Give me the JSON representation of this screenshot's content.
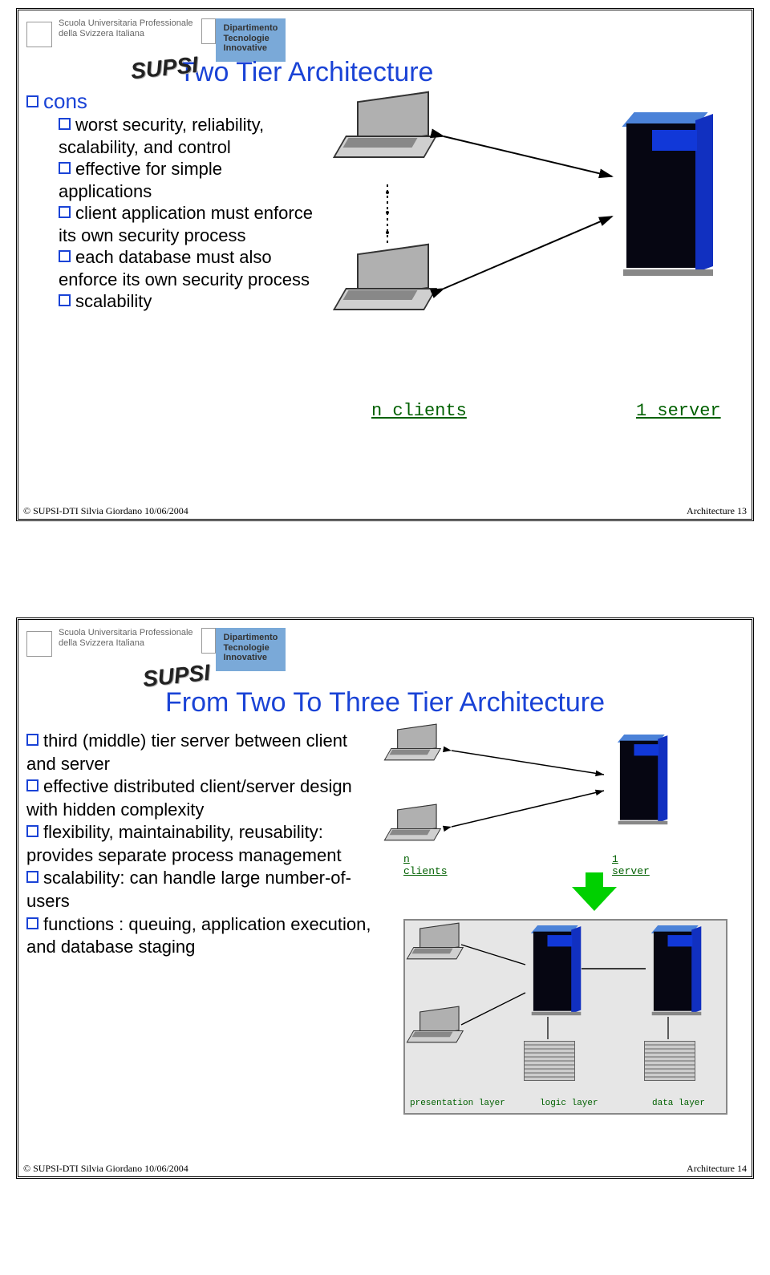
{
  "slide1": {
    "header": {
      "uni_line1": "Scuola Universitaria Professionale",
      "uni_line2": "della Svizzera Italiana",
      "logo": "SUPSI",
      "dip_line1": "Dipartimento",
      "dip_line2": "Tecnologie",
      "dip_line3": "Innovative"
    },
    "title": "Two Tier Architecture",
    "head_bullet": "cons",
    "bullets": [
      "worst security, reliability, scalability, and control",
      "effective for simple applications",
      "client application must enforce its own security process",
      "each database must also enforce its own security process",
      "scalability"
    ],
    "diagram": {
      "clients_label": "n clients",
      "server_label": "1 server"
    },
    "footer": {
      "left": "© SUPSI-DTI    Silvia Giordano    10/06/2004",
      "right": "Architecture  13"
    }
  },
  "slide2": {
    "header": {
      "uni_line1": "Scuola Universitaria Professionale",
      "uni_line2": "della Svizzera Italiana",
      "logo": "SUPSI",
      "dip_line1": "Dipartimento",
      "dip_line2": "Tecnologie",
      "dip_line3": "Innovative"
    },
    "title": "From Two To Three Tier Architecture",
    "bullets": [
      "third (middle) tier server between client and server",
      "effective distributed client/server design with hidden complexity",
      "flexibility, maintainability, reusability: provides separate process management",
      "scalability: can handle large number-of-users",
      "functions : queuing, application execution, and database staging"
    ],
    "diagram_top": {
      "clients_label": "n clients",
      "server_label": "1 server"
    },
    "diagram_bottom": {
      "layer1": "presentation layer",
      "layer2": "logic layer",
      "layer3": "data layer"
    },
    "footer": {
      "left": "© SUPSI-DTI    Silvia Giordano    10/06/2004",
      "right": "Architecture  14"
    }
  }
}
